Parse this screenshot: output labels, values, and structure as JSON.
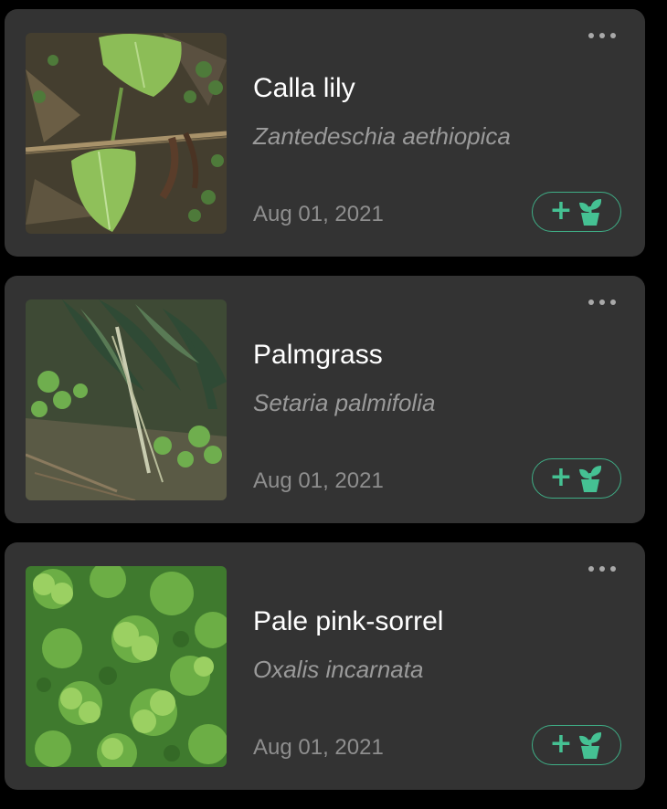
{
  "colors": {
    "background": "#000000",
    "card": "#333333",
    "accent": "#45c193",
    "title": "#ffffff",
    "subtitle": "#9a9a9a"
  },
  "plants": [
    {
      "common_name": "Calla lily",
      "scientific_name": "Zantedeschia aethiopica",
      "date": "Aug 01, 2021",
      "photo": "calla-lily-leaves-photo",
      "add_icon": "add-plant-icon",
      "more_icon": "more-dots-icon"
    },
    {
      "common_name": "Palmgrass",
      "scientific_name": "Setaria palmifolia",
      "date": "Aug 01, 2021",
      "photo": "palmgrass-photo",
      "add_icon": "add-plant-icon",
      "more_icon": "more-dots-icon"
    },
    {
      "common_name": "Pale pink-sorrel",
      "scientific_name": "Oxalis incarnata",
      "date": "Aug 01, 2021",
      "photo": "clover-sorrel-photo",
      "add_icon": "add-plant-icon",
      "more_icon": "more-dots-icon"
    }
  ]
}
